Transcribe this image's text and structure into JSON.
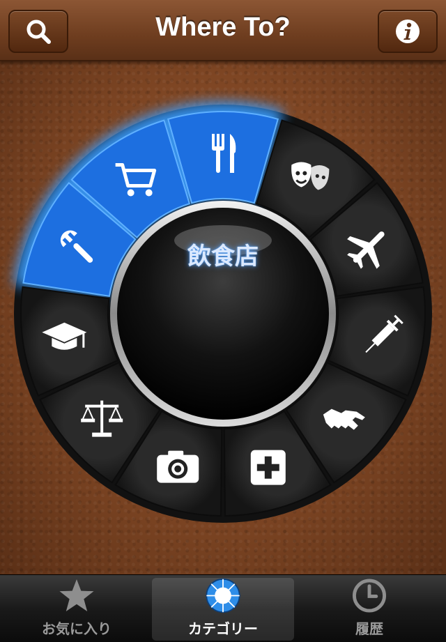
{
  "navbar": {
    "title": "Where To?",
    "left_button_icon": "search-icon",
    "right_button_icon": "info-icon"
  },
  "dial": {
    "selected_label": "飲食店",
    "segments": [
      {
        "icon": "fork-knife-icon",
        "selected": true
      },
      {
        "icon": "theater-masks-icon",
        "selected": false
      },
      {
        "icon": "airplane-icon",
        "selected": false
      },
      {
        "icon": "syringe-icon",
        "selected": false
      },
      {
        "icon": "handshake-icon",
        "selected": false
      },
      {
        "icon": "medical-cross-icon",
        "selected": false
      },
      {
        "icon": "camera-icon",
        "selected": false
      },
      {
        "icon": "scales-icon",
        "selected": false
      },
      {
        "icon": "graduation-cap-icon",
        "selected": false
      },
      {
        "icon": "wrench-icon",
        "selected": true
      },
      {
        "icon": "shopping-cart-icon",
        "selected": true
      }
    ],
    "accent_color": "#1d6fe0",
    "dark_color": "#1c1c1c"
  },
  "tabbar": {
    "tabs": [
      {
        "label": "お気に入り",
        "icon": "star-icon",
        "active": false
      },
      {
        "label": "カテゴリー",
        "icon": "category-wheel-icon",
        "active": true
      },
      {
        "label": "履歴",
        "icon": "clock-icon",
        "active": false
      }
    ]
  }
}
